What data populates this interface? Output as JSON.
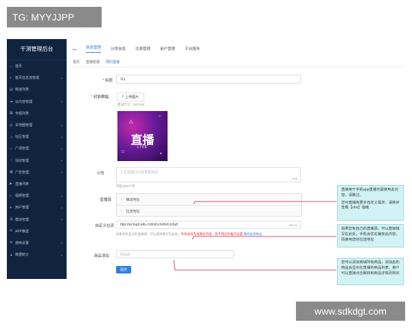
{
  "overlay": {
    "tag": "TG: MYYJJPP",
    "watermark": "www.sdkdgt.com"
  },
  "sidebar": {
    "title": "干测管理后台",
    "items": [
      {
        "icon": "home-icon",
        "label": "首页",
        "chevron": false
      },
      {
        "icon": "list-icon",
        "label": "首页信息流管理",
        "chevron": true
      },
      {
        "icon": "channel-icon",
        "label": "频道列表",
        "chevron": false
      },
      {
        "icon": "cloud-icon",
        "label": "云内容管理",
        "chevron": true
      },
      {
        "icon": "topic-icon",
        "label": "专题列表",
        "chevron": false
      },
      {
        "icon": "local-icon",
        "label": "本地圈管理",
        "chevron": true
      },
      {
        "icon": "community-icon",
        "label": "社区管理",
        "chevron": true
      },
      {
        "icon": "ad-icon",
        "label": "广场管理",
        "chevron": true
      },
      {
        "icon": "activity-icon",
        "label": "活动管理",
        "chevron": true
      },
      {
        "icon": "ads-icon",
        "label": "广告管理",
        "chevron": true
      },
      {
        "icon": "live-icon",
        "label": "直播列表",
        "chevron": false
      },
      {
        "icon": "video-icon",
        "label": "视频管理",
        "chevron": true
      },
      {
        "icon": "user-icon",
        "label": "用户管理",
        "chevron": true
      },
      {
        "icon": "module-icon",
        "label": "模块管理",
        "chevron": true
      },
      {
        "icon": "app-icon",
        "label": "APP推送",
        "chevron": false
      },
      {
        "icon": "settings-icon",
        "label": "通用设置",
        "chevron": true
      },
      {
        "icon": "stats-icon",
        "label": "数据统计",
        "chevron": true
      }
    ]
  },
  "topnav": {
    "tabs": [
      "信息管理",
      "分类信息",
      "交易管理",
      "用户管理",
      "平台服务"
    ],
    "active": 0
  },
  "subnav": {
    "items": [
      "首页",
      "直播管理",
      "预约直播"
    ],
    "active": 2
  },
  "form": {
    "title_label": "标题",
    "title_value": "111",
    "cover_label": "封面横幅",
    "upload_label": "上传图片",
    "cover_hint": "建议尺寸：200*200",
    "cover_big_text": "直播",
    "cover_small_text": "LIVE",
    "notice_label": "公告",
    "notice_placeholder": "上写直播间内容预告简述",
    "notice_counter": "0/80",
    "notice_hint": "不超过80个字",
    "stream_label": "直播源",
    "stream_rows": [
      "推流地址",
      "拉流地址"
    ],
    "custom_label": "自定义拉流",
    "custom_value": "http://wi.bupt.edu.cn/lnt/cctv6hd.m3u8",
    "custom_counter": "38/100",
    "custom_hint": "如果您有自己的直播源，可以直接填写在此处。",
    "custom_hint_red": "手机会优先观看此内容，而不用您的推流设置",
    "custom_hint_link": "我的拉流地址",
    "goods_label": "商品添加",
    "goods_placeholder": "商品库",
    "submit_label": "提交"
  },
  "notes": [
    "直接用于手机app直播无需使用此内容，请跳过。",
    "您可直播有更多自定义需求，请移步查看【obs】指南",
    "如果您有自己的直播源，可以直接填写在此处，手机会优先播放此内容，而使用您的拉流地址",
    "您可以添加商城所有商品，添加后的商品会显示在直播的商品列表，用户可以直接点击跳转到商品详情页购买"
  ],
  "colors": {
    "sidebar_bg": "#10233f",
    "accent": "#2f7ee4",
    "note_bg": "#d2f3f5",
    "connector": "#c2185b"
  }
}
